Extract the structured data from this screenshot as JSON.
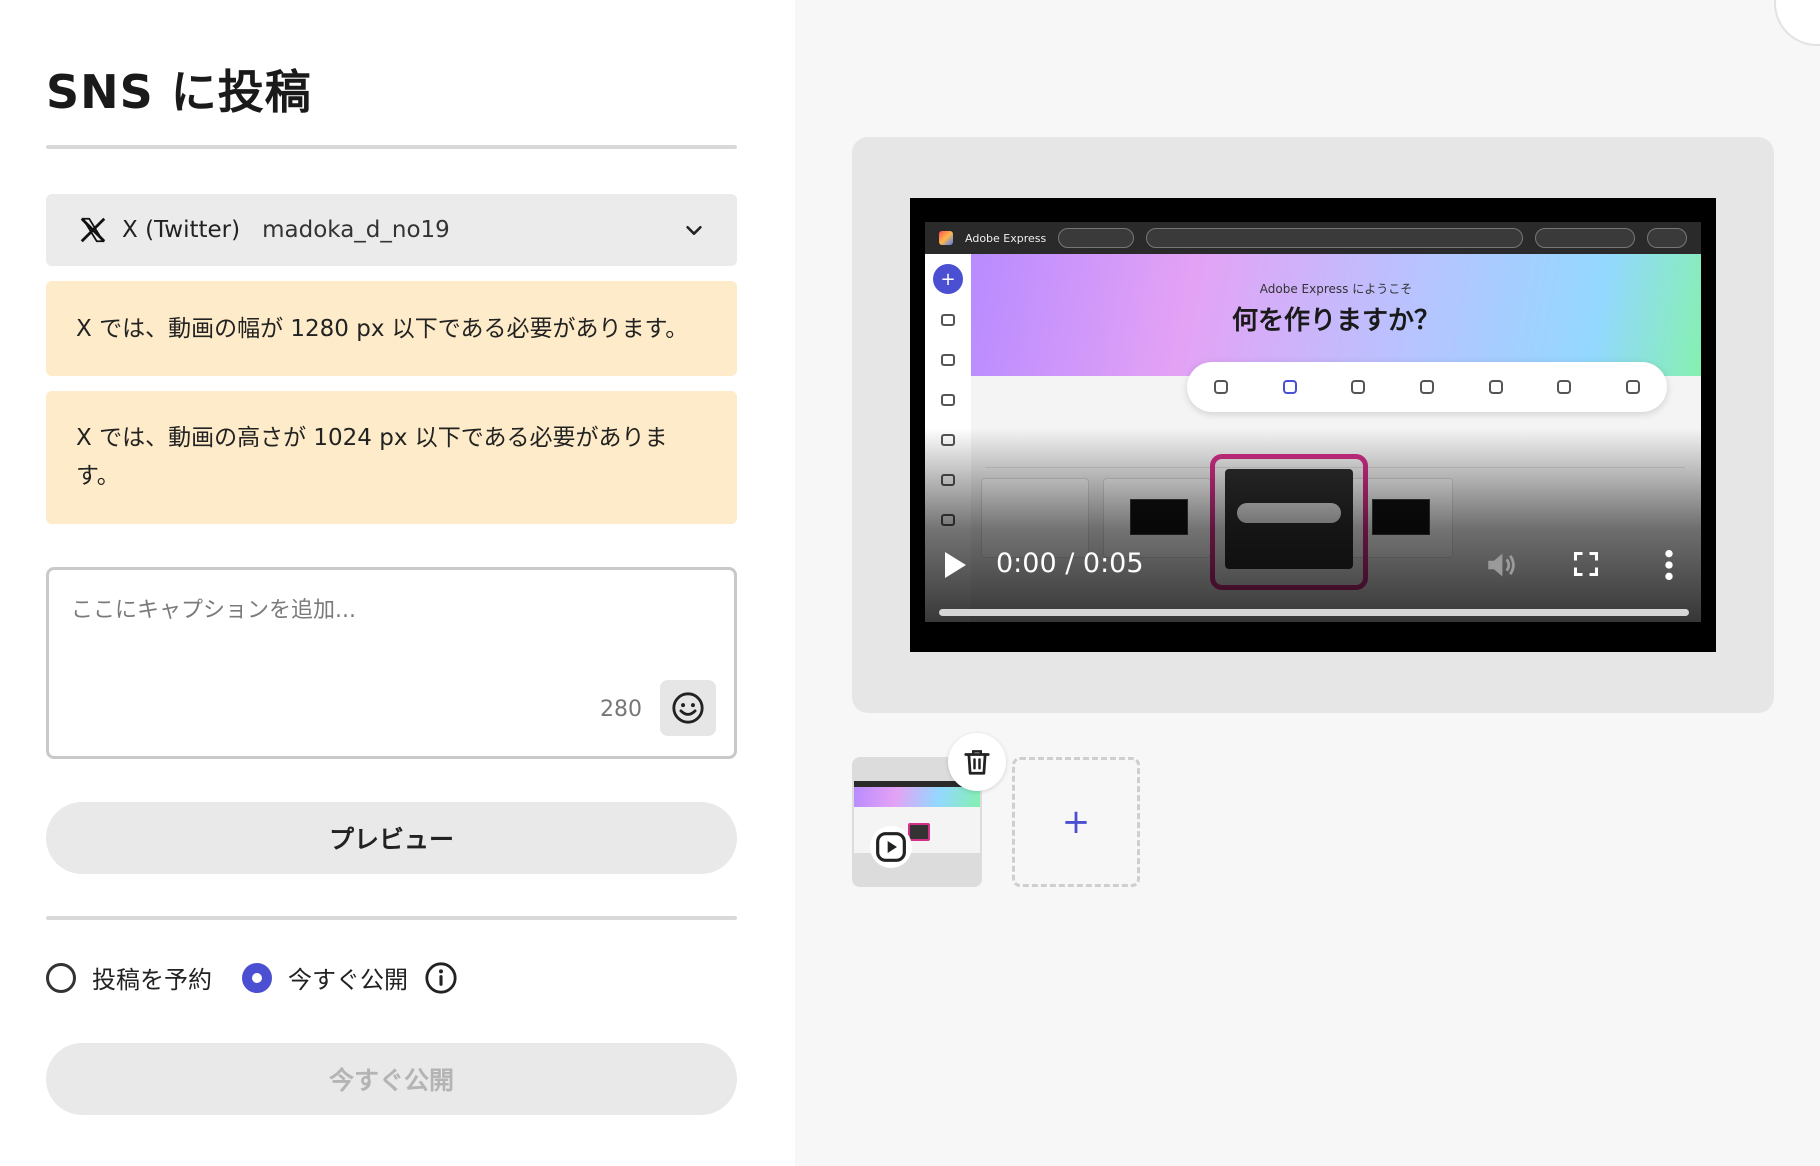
{
  "page": {
    "title": "SNS に投稿"
  },
  "account": {
    "platform": "X (Twitter)",
    "handle": "madoka_d_no19",
    "platform_icon": "x-logo-icon",
    "expand_icon": "chevron-down-icon"
  },
  "warnings": [
    "X では、動画の幅が 1280 px 以下である必要があります。",
    "X では、動画の高さが 1024 px 以下である必要があります。"
  ],
  "caption": {
    "value": "",
    "placeholder": "ここにキャプションを追加...",
    "char_remaining": "280",
    "emoji_icon": "smiley-icon"
  },
  "buttons": {
    "preview": "プレビュー",
    "publish": "今すぐ公開"
  },
  "publish_options": {
    "schedule_label": "投稿を予約",
    "now_label": "今すぐ公開",
    "selected": "now",
    "info_icon": "info-icon"
  },
  "video": {
    "time": "0:00 / 0:05",
    "progress": 0,
    "frame": {
      "brand": "Adobe Express",
      "welcome": "Adobe Express にようこそ",
      "headline": "何を作りますか？"
    }
  },
  "media": {
    "delete_icon": "trash-icon",
    "add_label": "+"
  },
  "colors": {
    "accent": "#4b4fd1",
    "warning_bg": "#fdebc9",
    "highlight": "#d62f8a"
  }
}
